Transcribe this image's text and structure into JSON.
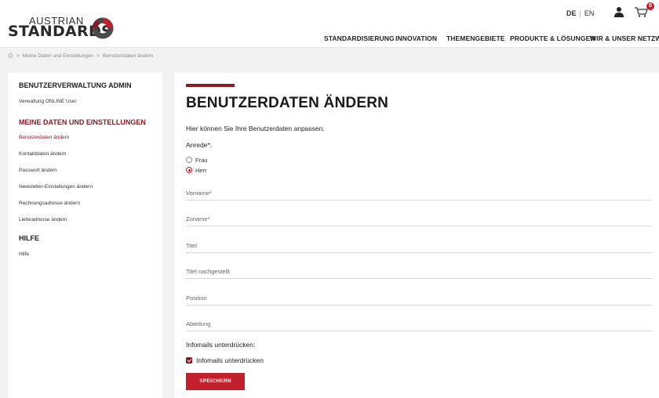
{
  "brand": {
    "line1": "AUSTRIAN",
    "line2": "STANDARDS",
    "colors": {
      "accent": "#8b1c24",
      "button": "#c3202e"
    }
  },
  "header": {
    "lang_active": "DE",
    "lang_separator": "|",
    "lang_other": "EN",
    "user_icon": "user-icon",
    "cart_icon": "cart-icon",
    "cart_count": "0"
  },
  "nav": {
    "items": [
      "STANDARDISIERUNG",
      "INNOVATION",
      "THEMENGEBIETE",
      "PRODUKTE & LÖSUNGEN",
      "WIR & UNSER NETZWERK"
    ]
  },
  "breadcrumb": {
    "home_icon": "home-icon",
    "separator": ">",
    "items": [
      "Meine Daten und Einstellungen",
      "Benutzerdaten ändern"
    ]
  },
  "sidebar": {
    "section1_title": "BENUTZERVERWALTUNG ADMIN",
    "section1_links": [
      "Verwaltung ONLINE User"
    ],
    "section2_title": "MEINE DATEN UND EINSTELLUNGEN",
    "section2_links": [
      "Benutzerdaten ändern",
      "Kontaktdaten ändern",
      "Passwort ändern",
      "Newsletter-Einstellungen ändern",
      "Rechnungsadresse ändern",
      "Lieferadresse ändern"
    ],
    "active_link": "Benutzerdaten ändern",
    "section3_title": "HILFE",
    "section3_links": [
      "Hilfe"
    ]
  },
  "main": {
    "title": "BENUTZERDATEN ÄNDERN",
    "intro": "Hier können Sie Ihre Benutzerdaten anpassen.",
    "anrede_label": "Anrede*:",
    "anrede_options": [
      "Frau",
      "Herr"
    ],
    "anrede_selected": "Herr",
    "fields": [
      {
        "placeholder": "Vorname*",
        "value": ""
      },
      {
        "placeholder": "Zuname*",
        "value": ""
      },
      {
        "placeholder": "Titel",
        "value": ""
      },
      {
        "placeholder": "Titel nachgestellt",
        "value": ""
      },
      {
        "placeholder": "Position",
        "value": ""
      },
      {
        "placeholder": "Abteilung",
        "value": ""
      }
    ],
    "infomails_label": "Infomails unterdrücken:",
    "infomails_checkbox": "Infomails unterdrücken",
    "infomails_checked": true,
    "save_label": "SPEICHERN"
  }
}
